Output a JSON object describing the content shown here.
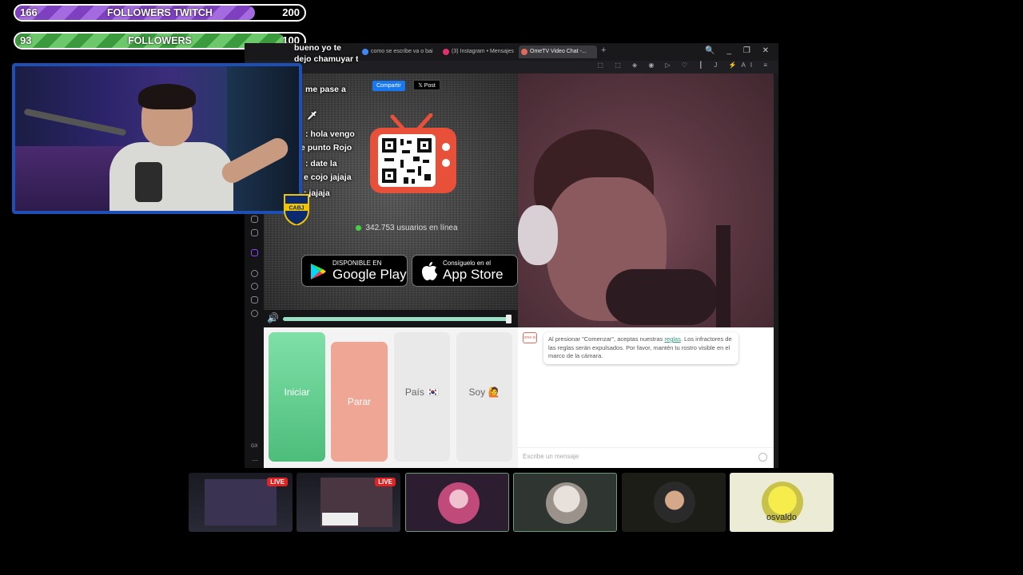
{
  "goals": [
    {
      "current": "166",
      "title": "FOLLOWERS TWITCH",
      "total": "200",
      "progress": 0.83
    },
    {
      "current": "93",
      "title": "FOLLOWERS",
      "total": "100",
      "progress": 0.93
    }
  ],
  "browser": {
    "tabs": [
      {
        "label": "como se escribe va o bai",
        "color": "#4285f4"
      },
      {
        "label": "(3) Instagram • Mensajes",
        "color": "#e1306c"
      },
      {
        "label": "OmeTV Video Chat -...",
        "color": "#e06b5c"
      }
    ],
    "new_tab": "+",
    "window_controls": "🔍 _ ❐ ✕",
    "toolbar_icons": "⬚ ⬚ ◈ ◉ ▷ ♡ ┃ J ⚡AI ≡"
  },
  "overlay_chat": [
    "bueno yo te",
    "dejo chamuyar tranqui",
    "me pase a",
    ": hola vengo",
    "e punto Rojo",
    ": date la",
    "e cojo jajaja",
    ": jajaja"
  ],
  "share": {
    "facebook": "Compartir",
    "x": "𝕏 Post"
  },
  "online": {
    "text": "342.753 usuarios en línea",
    "status_color": "#45d145"
  },
  "stores": {
    "google": {
      "small": "DISPONIBLE EN",
      "big": "Google Play"
    },
    "apple": {
      "small": "Consíguelo en el",
      "big": "App Store"
    }
  },
  "buttons": {
    "start": "Iniciar",
    "stop": "Parar",
    "country": "País 🇰🇷",
    "gender": "Soy 🙋"
  },
  "chat": {
    "logo": "ome.tv",
    "notice_before": "Al presionar \"Comenzar\", aceptas nuestras ",
    "notice_link": "reglas",
    "notice_after": ". Los infractores de las reglas serán expulsados. Por favor, mantén tu rostro visible en el marco de la cámara.",
    "input_placeholder": "Escribe un mensaje"
  },
  "badge": {
    "text": "CABJ"
  },
  "thumbnails": [
    {
      "live": "LIVE"
    },
    {
      "live": "LIVE"
    },
    {},
    {},
    {},
    {
      "name": "osvaldo"
    }
  ],
  "colors": {
    "webcam_border": "#1e4fb5",
    "goal_twitch": "#7e3fc0",
    "goal_followers": "#3b9a3e",
    "start_button": "#4dbd7b",
    "stop_button": "#f0a695"
  }
}
